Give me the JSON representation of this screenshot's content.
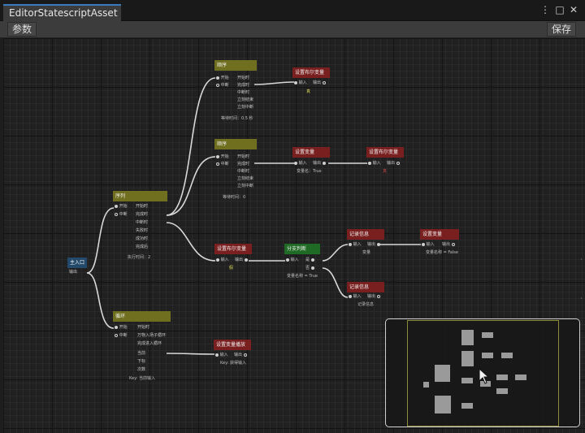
{
  "window": {
    "tab_title": "EditorStatescriptAsset",
    "controls": [
      "⋮",
      "□",
      "✕"
    ]
  },
  "toolbar": {
    "params_label": "参数",
    "save_label": "保存"
  },
  "graph": {
    "entry": {
      "title": "主入口",
      "out": "输出"
    },
    "seq_top": {
      "title": "序列",
      "in1": "开始",
      "in2": "中断",
      "outs": [
        "开始时",
        "完成时",
        "中断时",
        "失败时",
        "成功时",
        "完成后"
      ],
      "footer": "执行时间：2"
    },
    "seq_a": {
      "title": "顺序",
      "in1": "开始",
      "in2": "中断",
      "outs": [
        "开始时",
        "完成时",
        "中断时",
        "立刻结束",
        "立刻中断"
      ],
      "footer": "等待时间：0.5 秒"
    },
    "seq_b": {
      "title": "顺序",
      "in1": "开始",
      "in2": "中断",
      "outs": [
        "开始时",
        "完成时",
        "中断时",
        "立刻结束",
        "立刻中断"
      ],
      "footer": "等待时间：0"
    },
    "seq_c": {
      "title": "循环",
      "in1": "开始",
      "in2": "中断",
      "outs": [
        "开始时",
        "万物入场子循环",
        "完成进入循环",
        "当前",
        "下标",
        "次数"
      ],
      "footer": "Key: 当前输入"
    },
    "red_top": {
      "title": "设置布尔变量",
      "in": "输入",
      "out": "输出",
      "footer": "真"
    },
    "red_mid1": {
      "title": "设置变量",
      "in": "输入",
      "out": "输出",
      "footer": "变量名：True"
    },
    "red_mid2": {
      "title": "设置布尔变量",
      "in": "输入",
      "out": "输出",
      "footer": "真"
    },
    "red_check": {
      "title": "设置布尔变量",
      "in": "输入",
      "out": "输出",
      "footer": "假"
    },
    "green_branch": {
      "title": "分支判断",
      "in": "输入",
      "out_true": "是",
      "out_false": "否",
      "footer": "变量名称 = True"
    },
    "red_r1": {
      "title": "记录信息",
      "in": "输入",
      "out": "输出",
      "footer": "变量"
    },
    "red_r2": {
      "title": "设置变量",
      "in": "输入",
      "out": "输出",
      "footer": "变量名称 = False"
    },
    "red_r3": {
      "title": "记录信息",
      "in": "输入",
      "out": "输出",
      "footer": "记录信息"
    },
    "red_bottom": {
      "title": "设置变量播放",
      "in": "输入",
      "out": "输出",
      "footer": "Key: 获得输入"
    }
  },
  "minimap": {
    "label": "minimap"
  },
  "colors": {
    "accent": "#3a79bb",
    "olive": "#6f6f1f",
    "red": "#7a1f1f",
    "green": "#1f6a24",
    "blue": "#234a6a"
  }
}
